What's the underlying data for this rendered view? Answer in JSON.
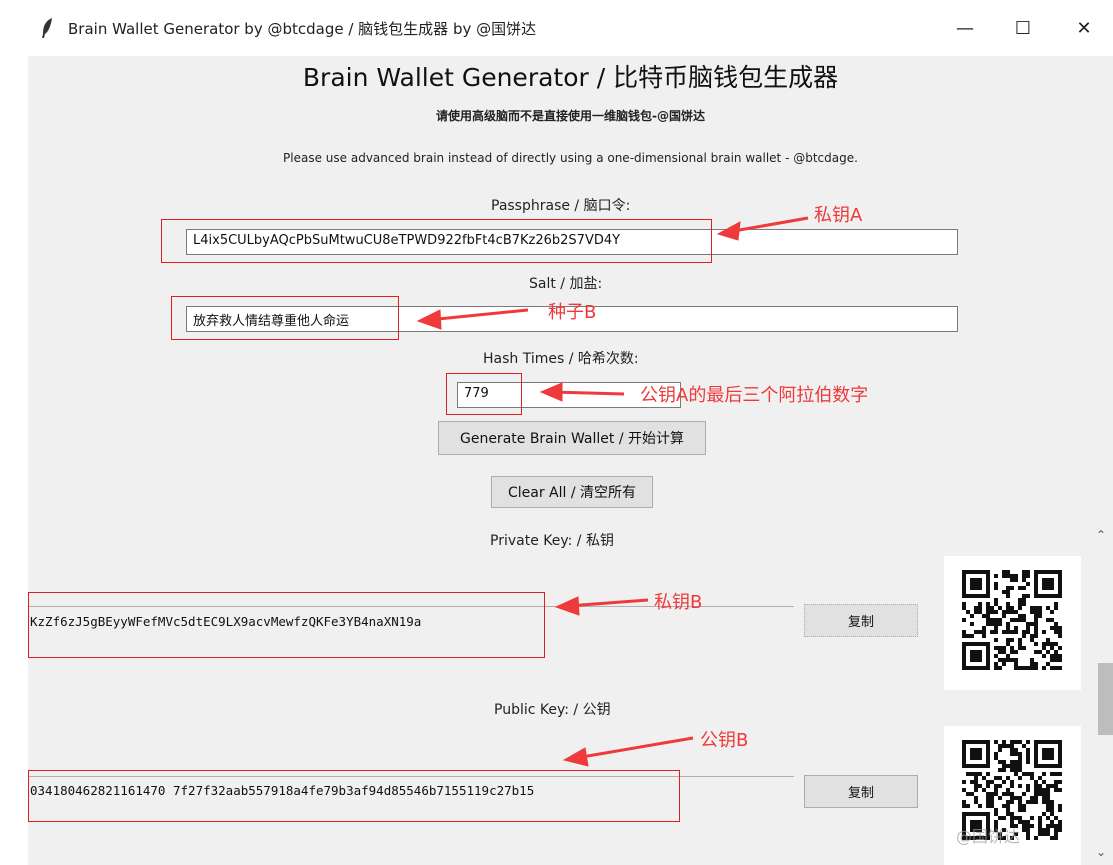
{
  "window": {
    "title": "Brain Wallet Generator by @btcdage / 脑钱包生成器 by @国饼达",
    "controls": {
      "minimize": "—",
      "maximize": "☐",
      "close": "✕"
    }
  },
  "header": {
    "title": "Brain Wallet Generator / 比特币脑钱包生成器",
    "subtitle_cn": "请使用高级脑而不是直接使用一维脑钱包-@国饼达",
    "subtitle_en": "Please use advanced brain instead of directly using a one-dimensional brain wallet - @btcdage."
  },
  "form": {
    "passphrase_label": "Passphrase / 脑口令:",
    "passphrase_value": "L4ix5CULbyAQcPbSuMtwuCU8eTPWD922fbFt4cB7Kz26b2S7VD4Y",
    "salt_label": "Salt / 加盐:",
    "salt_value": "放弃救人情结尊重他人命运",
    "hash_label": "Hash Times / 哈希次数:",
    "hash_value": "779",
    "generate_button": "Generate Brain Wallet / 开始计算",
    "clear_button": "Clear All / 清空所有"
  },
  "output": {
    "private_key_label": "Private Key: / 私钥",
    "private_key_value": "KzZf6zJ5gBEyyWFefMVc5dtEC9LX9acvMewfzQKFe3YB4naXN19a",
    "public_key_label": "Public Key: / 公钥",
    "public_key_value": "034180462821161470 7f27f32aab557918a4fe79b3af94d85546b7155119c27b15",
    "copy_label": "复制"
  },
  "annotations": {
    "private_a": "私钥A",
    "seed_b": "种子B",
    "hash_note": "公钥A的最后三个阿拉伯数字",
    "private_b": "私钥B",
    "public_b": "公钥B"
  },
  "watermark": "@国饼达",
  "colors": {
    "annotation": "#ee3a3a",
    "window_bg": "#f0f0f0"
  }
}
